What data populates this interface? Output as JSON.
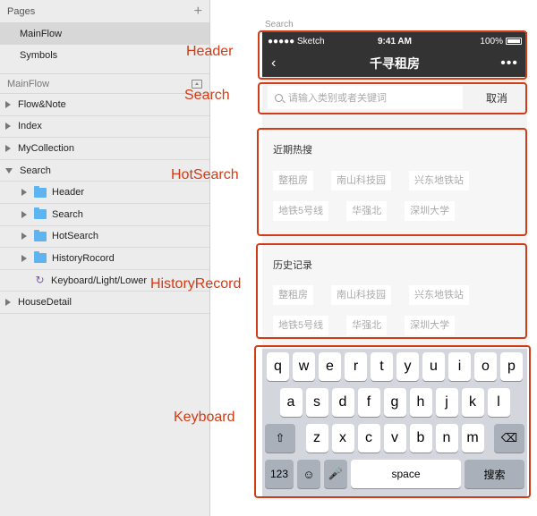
{
  "sidebar": {
    "pages_label": "Pages",
    "pages": [
      {
        "label": "MainFlow",
        "selected": true
      },
      {
        "label": "Symbols",
        "selected": false
      }
    ],
    "section_label": "MainFlow",
    "layers": [
      {
        "label": "Flow&Note"
      },
      {
        "label": "Index"
      },
      {
        "label": "MyCollection"
      },
      {
        "label": "Search"
      },
      {
        "label": "Header"
      },
      {
        "label": "Search"
      },
      {
        "label": "HotSearch"
      },
      {
        "label": "HistoryRocord"
      },
      {
        "label": "Keyboard/Light/Lower"
      },
      {
        "label": "HouseDetail"
      }
    ]
  },
  "canvas": {
    "artboard_label": "Search",
    "status": {
      "carrier": "●●●●● Sketch",
      "time": "9:41 AM",
      "battery": "100%"
    },
    "nav": {
      "title": "千寻租房",
      "back": "‹",
      "more": "•••"
    },
    "search": {
      "placeholder": "请输入类别或者关键词",
      "cancel": "取消"
    },
    "hot": {
      "title": "近期热搜",
      "tags": [
        "整租房",
        "南山科技园",
        "兴东地铁站",
        "地铁5号线",
        "华强北",
        "深圳大学"
      ]
    },
    "history": {
      "title": "历史记录",
      "tags": [
        "整租房",
        "南山科技园",
        "兴东地铁站",
        "地铁5号线",
        "华强北",
        "深圳大学"
      ]
    },
    "keyboard": {
      "row1": [
        "q",
        "w",
        "e",
        "r",
        "t",
        "y",
        "u",
        "i",
        "o",
        "p"
      ],
      "row2": [
        "a",
        "s",
        "d",
        "f",
        "g",
        "h",
        "j",
        "k",
        "l"
      ],
      "row3": [
        "z",
        "x",
        "c",
        "v",
        "b",
        "n",
        "m"
      ],
      "num": "123",
      "space": "space",
      "search": "搜索"
    }
  },
  "annotations": {
    "header": "Header",
    "search": "Search",
    "hot": "HotSearch",
    "history": "HistoryRecord",
    "keyboard": "Keyboard"
  }
}
